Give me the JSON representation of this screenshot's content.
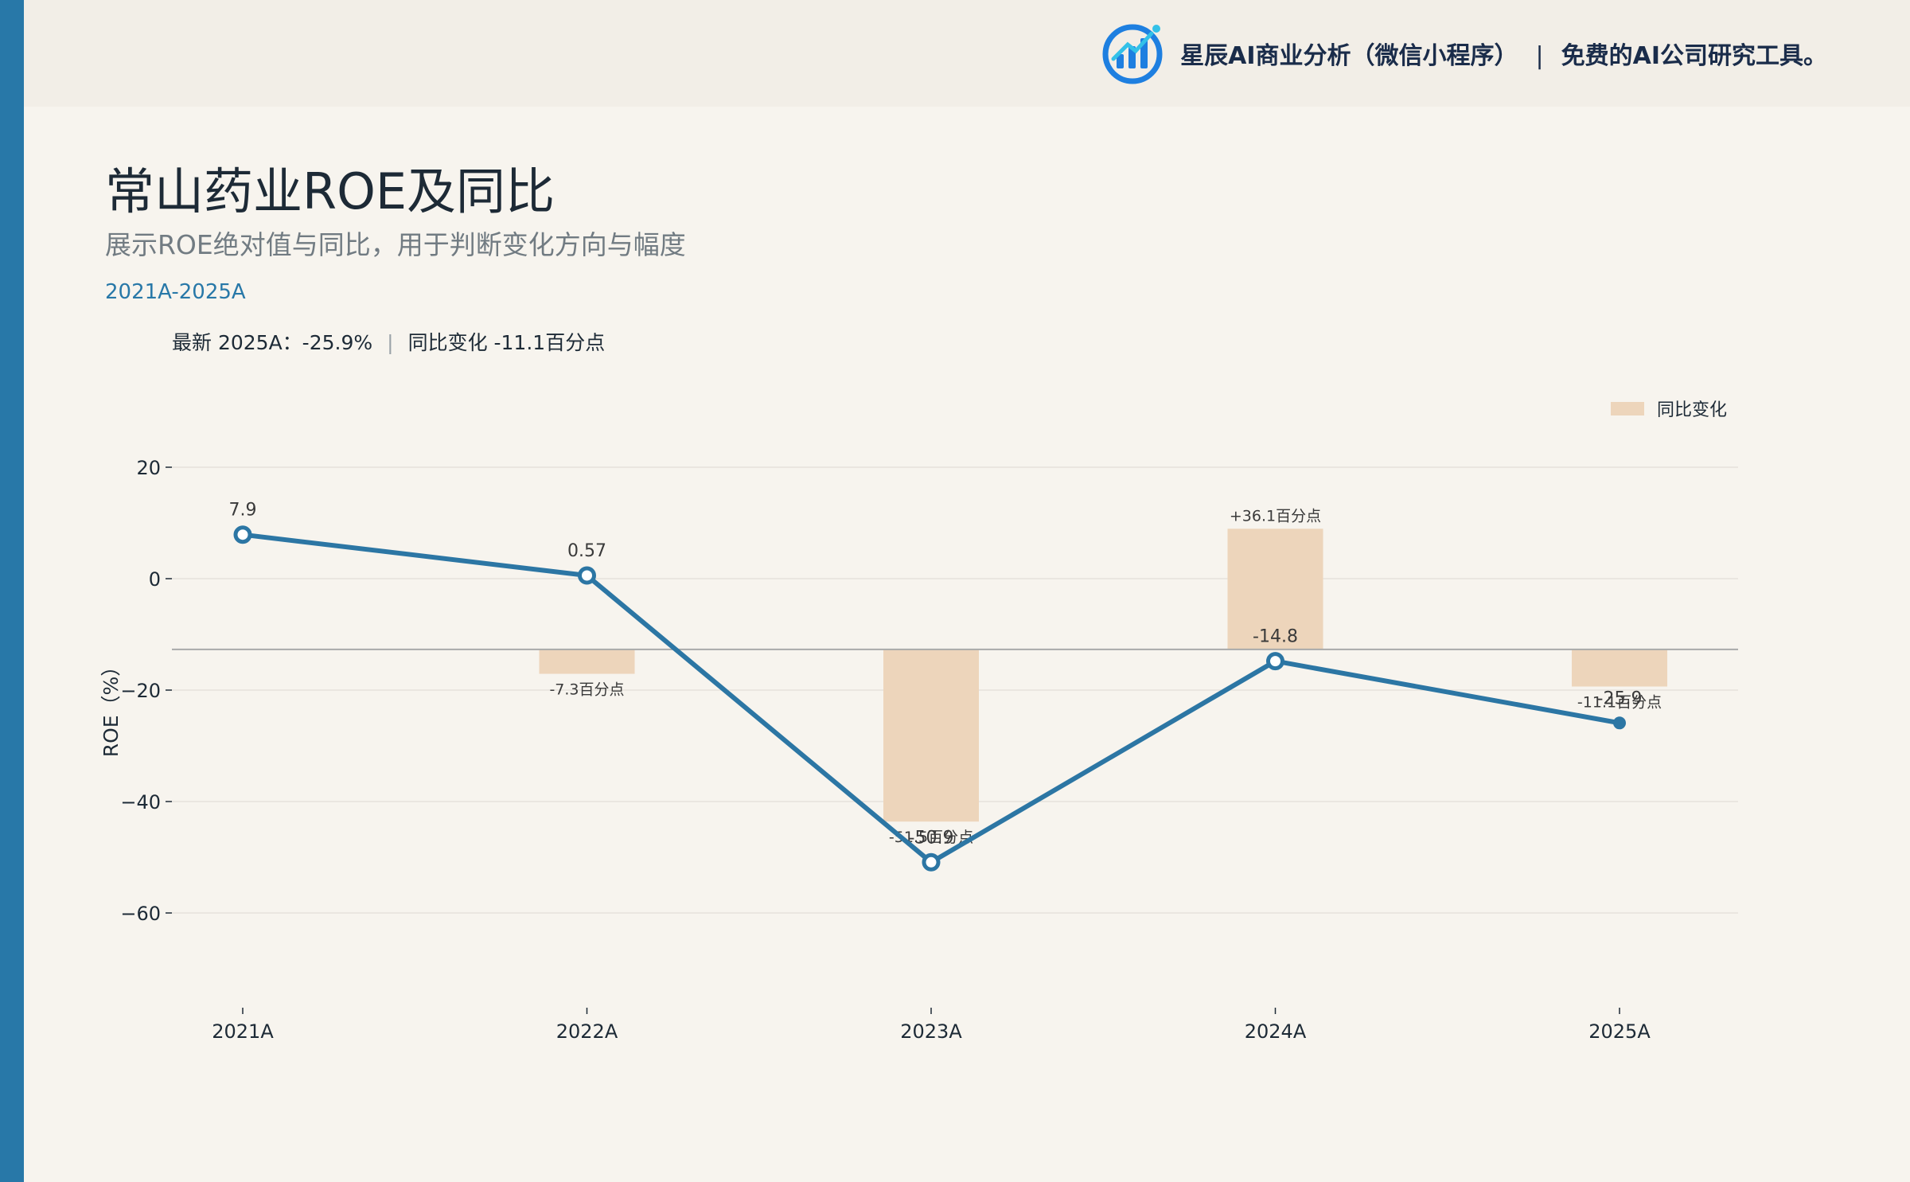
{
  "brand": {
    "logo_icon": "bar-chart-growth-icon",
    "name": "星辰AI商业分析（微信小程序）",
    "separator": "|",
    "tagline": "免费的AI公司研究工具。"
  },
  "header": {
    "title": "常山药业ROE及同比",
    "subtitle": "展示ROE绝对值与同比，用于判断变化方向与幅度",
    "period": "2021A-2025A"
  },
  "summary": {
    "latest": "最新 2025A：-25.9%",
    "separator": "|",
    "change": "同比变化 -11.1百分点"
  },
  "colors": {
    "line": "#2c76a4",
    "bar": "#edd5bb",
    "accent": "#2878a8"
  },
  "chart_data": {
    "type": "line",
    "categories": [
      "2021A",
      "2022A",
      "2023A",
      "2024A",
      "2025A"
    ],
    "ylabel": "ROE（%）",
    "ylim": [
      -72,
      33
    ],
    "yticks": [
      20,
      0,
      -20,
      -40,
      -60
    ],
    "ytick_labels": [
      "20",
      "0",
      "−20",
      "−40",
      "−60"
    ],
    "grid": true,
    "legend": {
      "position": "top-right",
      "label": "同比变化"
    },
    "series": [
      {
        "values": [
          7.9,
          0.57,
          -50.9,
          -14.8,
          -25.9
        ],
        "labels": [
          "7.9",
          "0.57",
          "-50.9",
          "-14.8",
          "-25.9"
        ]
      }
    ],
    "yoy_bars": {
      "name": "同比变化",
      "baseline": -12.7,
      "values": [
        null,
        -7.3,
        -51.5,
        36.1,
        -11.1
      ],
      "labels": [
        "",
        "-7.3百分点",
        "-51.5百分点",
        "+36.1百分点",
        "-11.1百分点"
      ]
    }
  }
}
